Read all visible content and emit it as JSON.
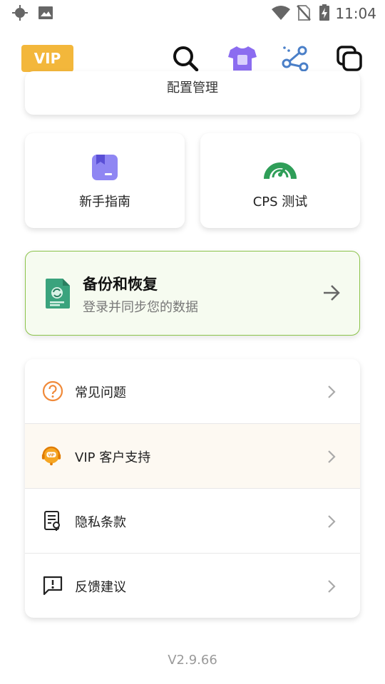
{
  "status_bar": {
    "time": "11:04",
    "icons": [
      "location-icon",
      "image-icon",
      "wifi-icon",
      "no-sim-icon",
      "battery-charging-icon"
    ]
  },
  "header": {
    "vip_label": "VIP",
    "icons": [
      "search-icon",
      "theme-shirt-icon",
      "share-icon",
      "window-copy-icon"
    ],
    "accent": "#f3b73b"
  },
  "cut_card": {
    "label": "配置管理"
  },
  "tiles": [
    {
      "label": "新手指南",
      "icon": "guide-book-icon"
    },
    {
      "label": "CPS 测试",
      "icon": "speedometer-icon"
    }
  ],
  "backup": {
    "title": "备份和恢复",
    "subtitle": "登录并同步您的数据",
    "icon": "backup-file-icon",
    "border_color": "#8bc34a"
  },
  "menu": [
    {
      "label": "常见问题",
      "icon": "question-icon"
    },
    {
      "label": "VIP 客户支持",
      "icon": "vip-support-icon"
    },
    {
      "label": "隐私条款",
      "icon": "privacy-document-icon"
    },
    {
      "label": "反馈建议",
      "icon": "feedback-icon"
    }
  ],
  "version": "V2.9.66"
}
